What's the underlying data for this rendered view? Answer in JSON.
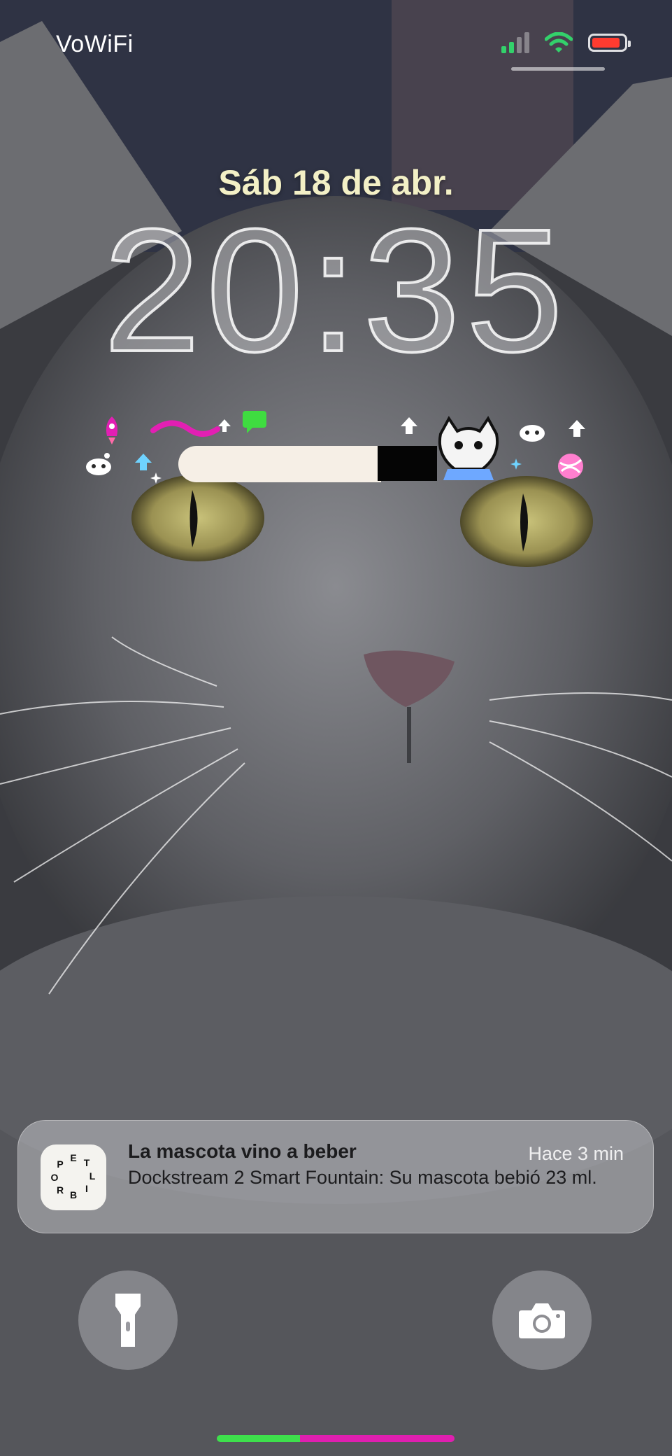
{
  "status_bar": {
    "carrier": "VoWiFi",
    "icons": [
      "cellular-signal-icon",
      "wifi-icon",
      "battery-icon"
    ],
    "battery_color": "#ff3b30",
    "signal_color": "#33d16b"
  },
  "lock_screen": {
    "date": "Sáb 18 de abr.",
    "time": "20:35"
  },
  "widgets": {
    "icons": [
      "rocket-icon",
      "reddit-alien-icon",
      "arrow-up-icon",
      "chat-bubble-icon",
      "cat-icon",
      "sparkle-icon"
    ]
  },
  "notification": {
    "app_name": "PETLIBRO",
    "icon_letters": [
      "P",
      "E",
      "T",
      "L",
      "I",
      "B",
      "R",
      "O"
    ],
    "title": "La mascota vino a beber",
    "time": "Hace 3 min",
    "body": "Dockstream 2 Smart Fountain: Su mascota bebió 23 ml."
  },
  "quick_actions": {
    "left": "flashlight-icon",
    "right": "camera-icon"
  }
}
